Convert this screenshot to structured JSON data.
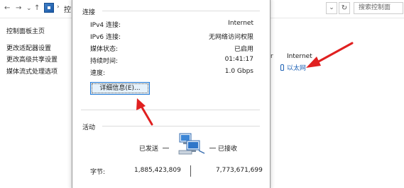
{
  "explorer": {
    "nav_back": "←",
    "nav_forward": "→",
    "nav_dropdown": "⌄",
    "nav_up": "↑",
    "crumb_separator": "›",
    "breadcrumb": "控",
    "search_placeholder": "搜索控制面",
    "sidebar": [
      "控制面板主页",
      "更改适配器设置",
      "更改高级共享设置",
      "媒体流式处理选项"
    ],
    "access_type_stub": "r",
    "access_type": "Internet",
    "connection_link": "以太网"
  },
  "dialog": {
    "connection_section": "连接",
    "rows": [
      {
        "label": "IPv4 连接:",
        "value": "Internet"
      },
      {
        "label": "IPv6 连接:",
        "value": "无网络访问权限"
      },
      {
        "label": "媒体状态:",
        "value": "已启用"
      },
      {
        "label": "持续时间:",
        "value": "01:41:17"
      },
      {
        "label": "速度:",
        "value": "1.0 Gbps"
      }
    ],
    "details_button": "详细信息(E)...",
    "activity_section": "活动",
    "sent_label": "已发送",
    "received_label": "已接收",
    "bytes_label": "字节:",
    "bytes_sent": "1,885,423,809",
    "bytes_received": "7,773,671,699"
  },
  "colors": {
    "link": "#1a5fb4",
    "annotation_arrow": "#e02020",
    "button_border": "#1e78d7"
  }
}
